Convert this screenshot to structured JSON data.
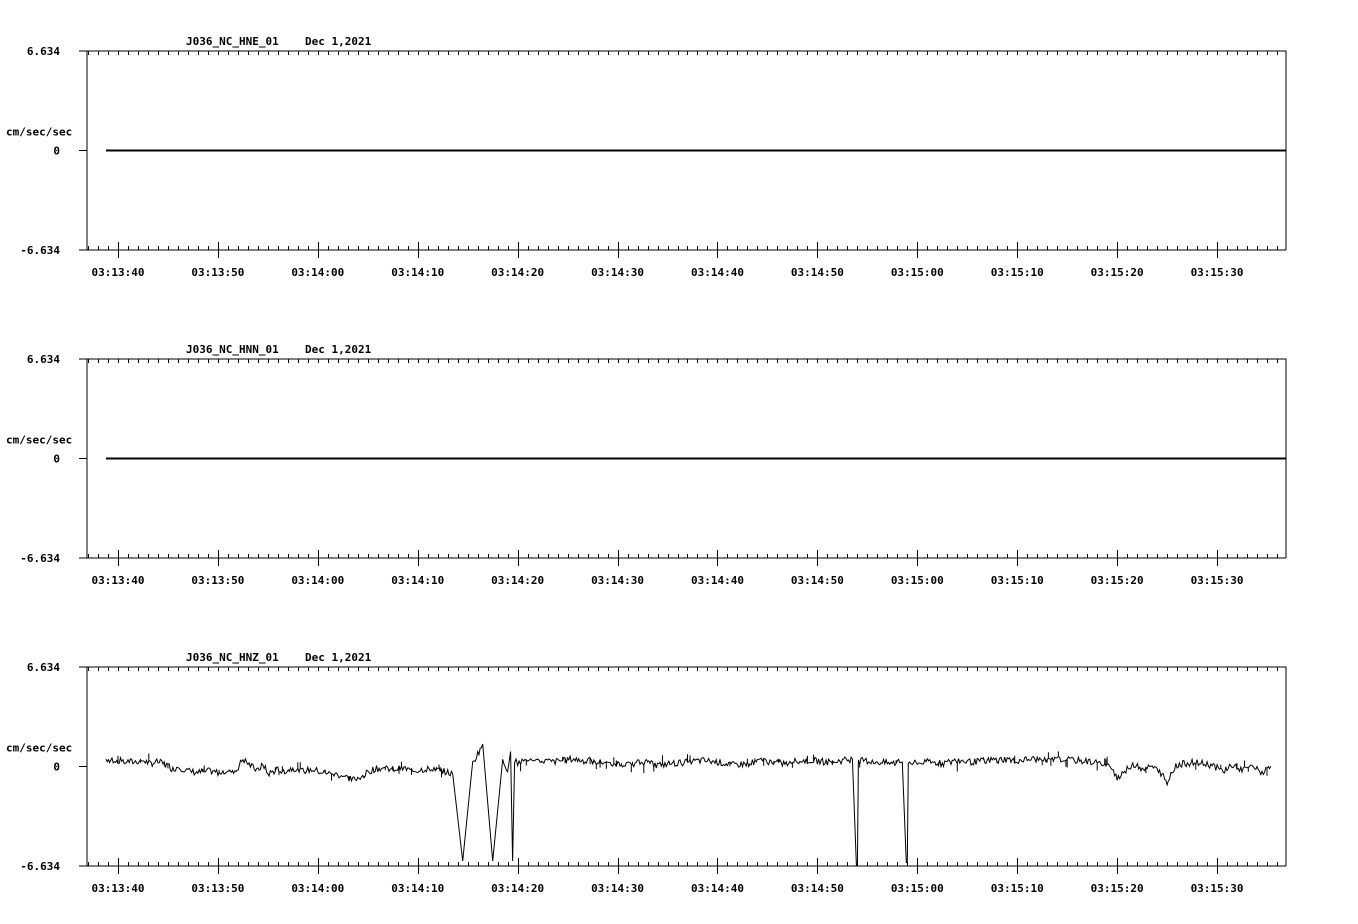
{
  "charts": [
    {
      "station_label": "J036_NC_HNE_01",
      "date_label": "Dec 1,2021",
      "units_label": "cm/sec/sec",
      "y_max_label": "6.634",
      "y_zero_label": "0",
      "y_min_label": "-6.634"
    },
    {
      "station_label": "J036_NC_HNN_01",
      "date_label": "Dec 1,2021",
      "units_label": "cm/sec/sec",
      "y_max_label": "6.634",
      "y_zero_label": "0",
      "y_min_label": "-6.634"
    },
    {
      "station_label": "J036_NC_HNZ_01",
      "date_label": "Dec 1,2021",
      "units_label": "cm/sec/sec",
      "y_max_label": "6.634",
      "y_zero_label": "0",
      "y_min_label": "-6.634"
    }
  ],
  "chart_data": [
    {
      "type": "line",
      "channel": "HNE",
      "x_tick_labels": [
        "03:13:40",
        "03:13:50",
        "03:14:00",
        "03:14:10",
        "03:14:20",
        "03:14:30",
        "03:14:40",
        "03:14:50",
        "03:15:00",
        "03:15:10",
        "03:15:20",
        "03:15:30"
      ],
      "x_ticks_seconds": [
        0,
        10,
        20,
        30,
        40,
        50,
        60,
        70,
        80,
        90,
        100,
        110
      ],
      "xlim_seconds": [
        -3.1,
        116.9
      ],
      "ylim": [
        -6.634,
        6.634
      ],
      "x_seconds": [
        -1.2,
        116.9
      ],
      "y": [
        0,
        0
      ],
      "grid": false
    },
    {
      "type": "line",
      "channel": "HNN",
      "x_tick_labels": [
        "03:13:40",
        "03:13:50",
        "03:14:00",
        "03:14:10",
        "03:14:20",
        "03:14:30",
        "03:14:40",
        "03:14:50",
        "03:15:00",
        "03:15:10",
        "03:15:20",
        "03:15:30"
      ],
      "x_ticks_seconds": [
        0,
        10,
        20,
        30,
        40,
        50,
        60,
        70,
        80,
        90,
        100,
        110
      ],
      "xlim_seconds": [
        -3.1,
        116.9
      ],
      "ylim": [
        -6.634,
        6.634
      ],
      "x_seconds": [
        -1.2,
        116.9
      ],
      "y": [
        0,
        0
      ],
      "grid": false
    },
    {
      "type": "line",
      "channel": "HNZ",
      "x_tick_labels": [
        "03:13:40",
        "03:13:50",
        "03:14:00",
        "03:14:10",
        "03:14:20",
        "03:14:30",
        "03:14:40",
        "03:14:50",
        "03:15:00",
        "03:15:10",
        "03:15:20",
        "03:15:30"
      ],
      "x_ticks_seconds": [
        0,
        10,
        20,
        30,
        40,
        50,
        60,
        70,
        80,
        90,
        100,
        110
      ],
      "xlim_seconds": [
        -3.1,
        116.9
      ],
      "ylim": [
        -6.634,
        6.634
      ],
      "grid": false,
      "x_seconds": [
        -1.2,
        0.0,
        1.5,
        2.5,
        3.2,
        4.0,
        5.0,
        5.5,
        6.0,
        7.0,
        8.0,
        9.0,
        10.0,
        11.0,
        11.8,
        12.5,
        13.0,
        14.0,
        14.5,
        15.0,
        16.0,
        16.8,
        17.5,
        18.5,
        19.5,
        20.5,
        21.5,
        22.5,
        23.5,
        24.5,
        25.5,
        26.5,
        27.5,
        28.5,
        29.5,
        30.5,
        31.5,
        32.5,
        33.5,
        34.5,
        35.5,
        36.5,
        37.5,
        38.5,
        39.0,
        39.3,
        39.5,
        39.7,
        40.0,
        40.3,
        40.6,
        41.0,
        41.3,
        41.7,
        42.0,
        42.5,
        43.5,
        44.5,
        45.5,
        46.5,
        48.0,
        49.5,
        51.0,
        52.5,
        54.0,
        55.5,
        57.0,
        58.5,
        60.0,
        61.5,
        63.0,
        64.5,
        65.5,
        66.5,
        68.0,
        69.5,
        71.0,
        72.5,
        73.5,
        73.9,
        74.0,
        74.1,
        74.5,
        76.0,
        77.5,
        78.5,
        78.9,
        79.0,
        79.1,
        79.5,
        81.0,
        82.5,
        84.0,
        85.5,
        87.0,
        88.5,
        90.0,
        91.5,
        93.0,
        94.5,
        96.0,
        97.5,
        98.5,
        99.5,
        100.0,
        100.5,
        101.0,
        101.8,
        102.5,
        103.5,
        104.5,
        105.0,
        105.5,
        106.0,
        106.8,
        107.5,
        108.5,
        109.5,
        110.5,
        111.5,
        112.5,
        113.5,
        114.5,
        115.5,
        116.3,
        116.9
      ],
      "y": [
        0.5,
        0.4,
        0.3,
        0.4,
        0.2,
        0.3,
        0.1,
        -0.2,
        0.0,
        -0.3,
        -0.4,
        -0.3,
        -0.4,
        -0.2,
        -0.3,
        0.5,
        0.2,
        -0.3,
        0.2,
        -0.5,
        -0.2,
        -0.3,
        -0.1,
        -0.3,
        -0.2,
        -0.4,
        -0.5,
        -0.6,
        -0.9,
        -0.6,
        -0.2,
        -0.1,
        -0.2,
        -0.1,
        -0.3,
        -0.2,
        -0.1,
        -0.3,
        -0.5,
        -6.3,
        0.2,
        1.5,
        -6.3,
        0.3,
        -0.2,
        1.0,
        -6.3,
        0.5,
        0.1,
        0.3,
        0.4,
        0.5,
        0.4,
        0.2,
        0.3,
        0.4,
        0.3,
        0.4,
        0.5,
        0.4,
        0.3,
        0.2,
        0.1,
        0.3,
        0.1,
        0.2,
        0.3,
        0.4,
        0.3,
        0.1,
        0.2,
        0.4,
        0.3,
        0.2,
        0.4,
        0.4,
        0.3,
        0.4,
        0.5,
        -6.6,
        -6.6,
        0.3,
        0.4,
        0.3,
        0.2,
        0.3,
        -6.4,
        -6.4,
        0.3,
        0.2,
        0.3,
        0.2,
        0.4,
        0.3,
        0.4,
        0.5,
        0.4,
        0.5,
        0.4,
        0.5,
        0.4,
        0.3,
        0.2,
        0.0,
        -0.8,
        -0.4,
        -0.2,
        0.1,
        -0.1,
        0.0,
        -0.5,
        -1.2,
        -0.3,
        0.1,
        0.2,
        0.3,
        0.2,
        0.1,
        -0.3,
        0.1,
        -0.2,
        0.0,
        -0.4,
        -0.1
      ]
    }
  ]
}
